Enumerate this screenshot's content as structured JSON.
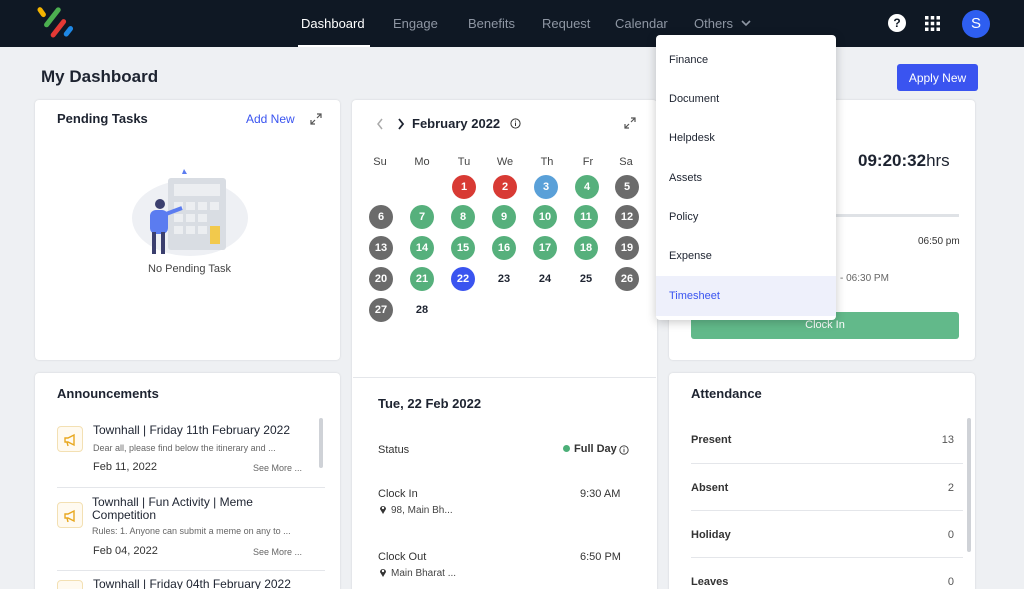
{
  "nav": {
    "items": [
      "Dashboard",
      "Engage",
      "Benefits",
      "Request",
      "Calendar",
      "Others"
    ],
    "active": "Dashboard",
    "help_glyph": "?",
    "avatar_initial": "S"
  },
  "page": {
    "title": "My Dashboard",
    "apply_label": "Apply New"
  },
  "pending": {
    "title": "Pending Tasks",
    "add_label": "Add New",
    "empty_text": "No Pending Task"
  },
  "calendar": {
    "month": "February 2022",
    "weekdays": [
      "Su",
      "Mo",
      "Tu",
      "We",
      "Th",
      "Fr",
      "Sa"
    ],
    "days": [
      "1",
      "2",
      "3",
      "4",
      "5",
      "6",
      "7",
      "8",
      "9",
      "10",
      "11",
      "12",
      "13",
      "14",
      "15",
      "16",
      "17",
      "18",
      "19",
      "20",
      "21",
      "22",
      "23",
      "24",
      "25",
      "26",
      "27",
      "28"
    ],
    "colors": {
      "red": "#d83a34",
      "blue": "#5aa0d8",
      "green": "#56b07c",
      "gray": "#6b6b6b",
      "selected": "#3a54f0"
    }
  },
  "detail": {
    "date": "Tue, 22 Feb 2022",
    "status_label": "Status",
    "status_value": "Full Day",
    "clock_in_label": "Clock In",
    "clock_in_time": "9:30 AM",
    "clock_in_loc": "98, Main Bh...",
    "clock_out_label": "Clock Out",
    "clock_out_time": "6:50 PM",
    "clock_out_loc": "Main Bharat ..."
  },
  "announcements": {
    "title": "Announcements",
    "items": [
      {
        "title": "Townhall | Friday 11th February 2022",
        "body": "Dear all, please find below the itinerary and ...",
        "date": "Feb 11, 2022",
        "more": "See More ..."
      },
      {
        "title": "Townhall | Fun Activity | Meme Competition",
        "body": "Rules: 1. Anyone can submit a meme on any to ...",
        "date": "Feb 04, 2022",
        "more": "See More ..."
      },
      {
        "title": "Townhall | Friday 04th February 2022"
      }
    ]
  },
  "timecard": {
    "time": "09:20:32",
    "time_unit": "hrs",
    "end_time": "06:50 pm",
    "shift_partial": "- 06:30 PM",
    "clock_in_label": "Clock In"
  },
  "attendance": {
    "title": "Attendance",
    "rows": [
      {
        "label": "Present",
        "value": "13"
      },
      {
        "label": "Absent",
        "value": "2"
      },
      {
        "label": "Holiday",
        "value": "0"
      },
      {
        "label": "Leaves",
        "value": "0"
      }
    ]
  },
  "others_menu": {
    "items": [
      "Finance",
      "Document",
      "Helpdesk",
      "Assets",
      "Policy",
      "Expense",
      "Timesheet"
    ],
    "active": "Timesheet"
  }
}
